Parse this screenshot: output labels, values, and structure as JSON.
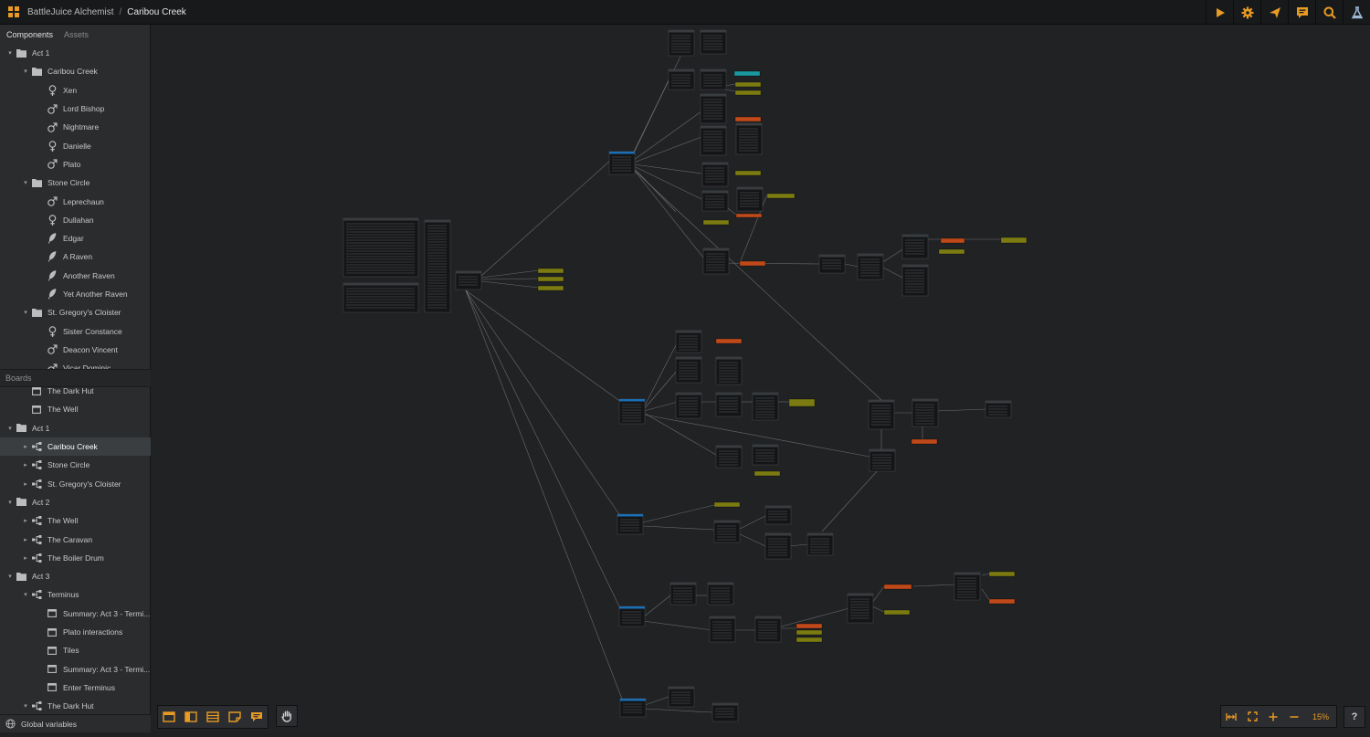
{
  "header": {
    "project": "BattleJuice Alchemist",
    "separator": "/",
    "board": "Caribou Creek"
  },
  "top_icons": [
    "play-icon",
    "gear-icon",
    "send-icon",
    "comment-icon",
    "search-icon",
    "flask-icon"
  ],
  "sidebar": {
    "tabs": [
      "Components",
      "Assets"
    ],
    "components": [
      {
        "label": "Act 1",
        "type": "folder",
        "depth": 0,
        "caret": "down"
      },
      {
        "label": "Caribou Creek",
        "type": "folder",
        "depth": 1,
        "caret": "down"
      },
      {
        "label": "Xen",
        "type": "female",
        "depth": 2
      },
      {
        "label": "Lord Bishop",
        "type": "male",
        "depth": 2
      },
      {
        "label": "Nightmare",
        "type": "male",
        "depth": 2
      },
      {
        "label": "Danielle",
        "type": "female",
        "depth": 2
      },
      {
        "label": "Plato",
        "type": "male",
        "depth": 2
      },
      {
        "label": "Stone Circle",
        "type": "folder",
        "depth": 1,
        "caret": "down"
      },
      {
        "label": "Leprechaun",
        "type": "male",
        "depth": 2
      },
      {
        "label": "Dullahan",
        "type": "female",
        "depth": 2
      },
      {
        "label": "Edgar",
        "type": "feather",
        "depth": 2
      },
      {
        "label": "A Raven",
        "type": "feather",
        "depth": 2
      },
      {
        "label": "Another Raven",
        "type": "feather",
        "depth": 2
      },
      {
        "label": "Yet Another Raven",
        "type": "feather",
        "depth": 2
      },
      {
        "label": "St. Gregory's Cloister",
        "type": "folder",
        "depth": 1,
        "caret": "down"
      },
      {
        "label": "Sister Constance",
        "type": "female",
        "depth": 2
      },
      {
        "label": "Deacon Vincent",
        "type": "male",
        "depth": 2
      },
      {
        "label": "Vicar Dominic",
        "type": "male",
        "depth": 2
      }
    ],
    "boards_label": "Boards",
    "boards": [
      {
        "label": "The Dark Hut",
        "type": "doc",
        "depth": 1
      },
      {
        "label": "The Well",
        "type": "doc",
        "depth": 1
      },
      {
        "label": "Act 1",
        "type": "folder",
        "depth": 0,
        "caret": "down"
      },
      {
        "label": "Caribou Creek",
        "type": "board",
        "depth": 1,
        "caret": "right",
        "selected": true
      },
      {
        "label": "Stone Circle",
        "type": "board",
        "depth": 1,
        "caret": "right"
      },
      {
        "label": "St. Gregory's Cloister",
        "type": "board",
        "depth": 1,
        "caret": "right"
      },
      {
        "label": "Act 2",
        "type": "folder",
        "depth": 0,
        "caret": "down"
      },
      {
        "label": "The Well",
        "type": "board",
        "depth": 1,
        "caret": "right"
      },
      {
        "label": "The Caravan",
        "type": "board",
        "depth": 1,
        "caret": "right"
      },
      {
        "label": "The Boiler Drum",
        "type": "board",
        "depth": 1,
        "caret": "right"
      },
      {
        "label": "Act 3",
        "type": "folder",
        "depth": 0,
        "caret": "down"
      },
      {
        "label": "Terminus",
        "type": "board",
        "depth": 1,
        "caret": "down"
      },
      {
        "label": "Summary: Act 3 - Termi...",
        "type": "doc",
        "depth": 2
      },
      {
        "label": "Plato interactions",
        "type": "doc",
        "depth": 2
      },
      {
        "label": "Tiles",
        "type": "doc",
        "depth": 2
      },
      {
        "label": "Summary: Act 3 - Termi...",
        "type": "doc",
        "depth": 2
      },
      {
        "label": "Enter Terminus",
        "type": "doc",
        "depth": 2
      },
      {
        "label": "The Dark Hut",
        "type": "board",
        "depth": 1,
        "caret": "down"
      }
    ],
    "global_variables": "Global variables"
  },
  "bottom_tools": [
    "frame-icon",
    "sidebar-panel-icon",
    "list-icon",
    "note-icon",
    "comment-box-icon",
    "hand-icon"
  ],
  "zoom": {
    "value": "15%",
    "buttons": [
      "fit-width-icon",
      "fit-screen-icon",
      "zoom-in-icon",
      "zoom-out-icon"
    ]
  },
  "help_label": "?",
  "colors": {
    "accent": "#e89b24",
    "node_header_blue": "#1b6fb5",
    "node_yellow": "#7b7b12",
    "node_orange": "#c0491a",
    "node_teal": "#1a9aa0"
  }
}
